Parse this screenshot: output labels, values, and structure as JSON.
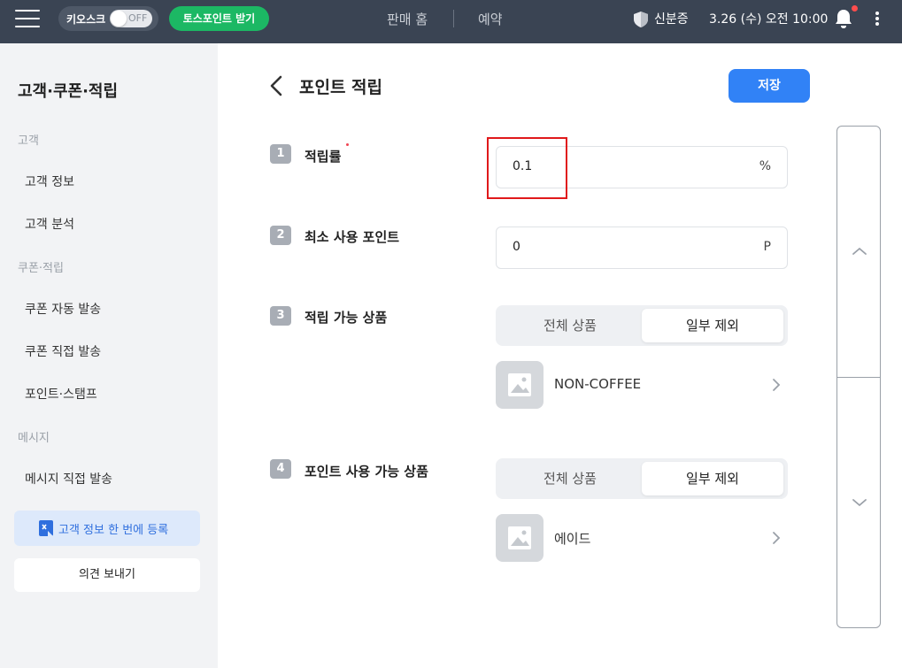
{
  "topbar": {
    "kiosk_label": "키오스크",
    "kiosk_state": "OFF",
    "toss_points_button": "토스포인트 받기",
    "nav": [
      "판매 홈",
      "예약"
    ],
    "verified_label": "신분증",
    "datetime": "3.26 (수) 오전 10:00",
    "icons": [
      "menu-icon",
      "shield-icon",
      "bell-icon",
      "more-vertical-icon"
    ]
  },
  "sidebar": {
    "title": "고객·쿠폰·적립",
    "groups": [
      {
        "label": "고객",
        "items": [
          "고객 정보",
          "고객 분석"
        ]
      },
      {
        "label": "쿠폰·적립",
        "items": [
          "쿠폰 자동 발송",
          "쿠폰 직접 발송",
          "포인트·스탬프"
        ]
      },
      {
        "label": "메시지",
        "items": [
          "메시지 직접 발송"
        ]
      }
    ],
    "register_button": "고객 정보 한 번에 등록",
    "feedback_button": "의견 보내기"
  },
  "main": {
    "title": "포인트 적립",
    "save_button": "저장",
    "steps": [
      {
        "num": "1",
        "label": "적립률",
        "required": true,
        "value": "0.1",
        "unit": "%"
      },
      {
        "num": "2",
        "label": "최소 사용 포인트",
        "value": "0",
        "unit": "P"
      },
      {
        "num": "3",
        "label": "적립 가능 상품",
        "options": [
          "전체 상품",
          "일부 제외"
        ],
        "selected": "일부 제외",
        "product": "NON-COFFEE"
      },
      {
        "num": "4",
        "label": "포인트 사용 가능 상품",
        "options": [
          "전체 상품",
          "일부 제외"
        ],
        "selected": "일부 제외",
        "product": "에이드"
      }
    ]
  },
  "colors": {
    "topbar": "#3a4453",
    "toss_green": "#1cb864",
    "primary_blue": "#3182f6",
    "highlight_red": "#e0191b",
    "sidebar_bg": "#f2f3f5"
  }
}
